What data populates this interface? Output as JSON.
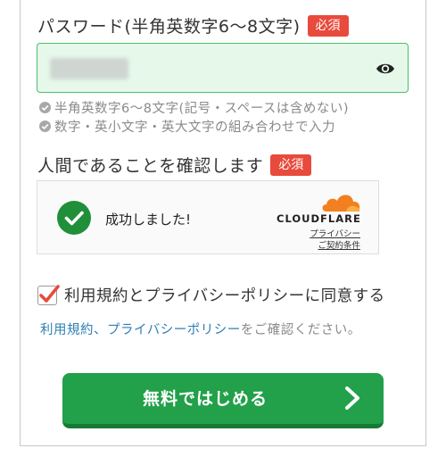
{
  "password": {
    "label": "パスワード(半角英数字6〜8文字)",
    "required_badge": "必須",
    "hints": [
      "半角英数字6〜8文字(記号・スペースは含めない)",
      "数字・英小文字・英大文字の組み合わせで入力"
    ]
  },
  "human_check": {
    "label": "人間であることを確認します",
    "required_badge": "必須",
    "status_text": "成功しました!",
    "provider_name": "CLOUDFLARE",
    "privacy_link": "プライバシー",
    "terms_link": "ご契約条件"
  },
  "agreement": {
    "checkbox_label": "利用規約とプライバシーポリシーに同意する",
    "checked": true
  },
  "policy_line": {
    "terms_link": "利用規約",
    "separator": "、",
    "privacy_link": "プライバシーポリシー",
    "suffix": "をご確認ください。"
  },
  "cta": {
    "label": "無料ではじめる"
  },
  "colors": {
    "accent_green": "#22a04a",
    "required_red": "#e84a3c",
    "link_blue": "#2f7fb5",
    "cloudflare_orange": "#f38020"
  }
}
